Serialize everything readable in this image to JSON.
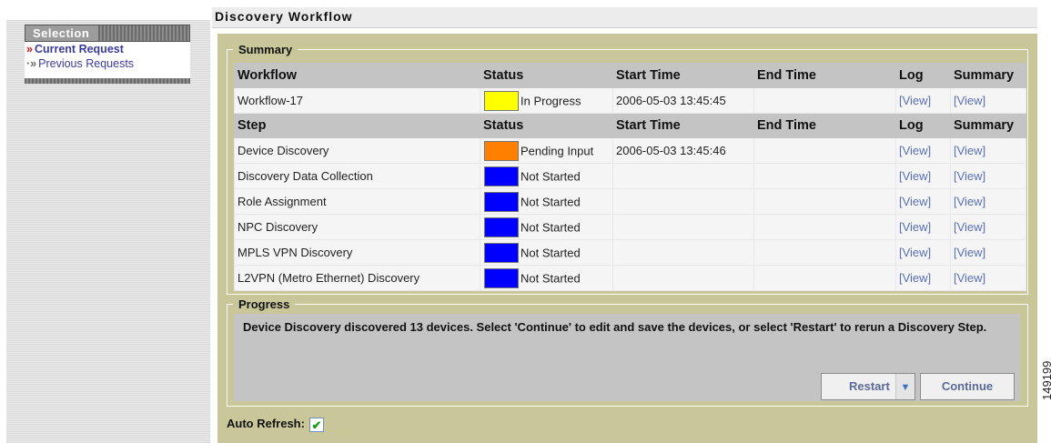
{
  "title": "Discovery Workflow",
  "sidebar": {
    "header": "Selection",
    "items": [
      {
        "label": "Current Request",
        "bullet": "»"
      },
      {
        "label": "Previous Requests",
        "bullet": "·»"
      }
    ]
  },
  "summary": {
    "legend": "Summary",
    "workflow_headers": [
      "Workflow",
      "Status",
      "Start Time",
      "End Time",
      "Log",
      "Summary"
    ],
    "workflow": {
      "name": "Workflow-17",
      "status": "In Progress",
      "status_color": "#ffff00",
      "start": "2006-05-03 13:45:45",
      "end": "",
      "log": "[View]",
      "summary": "[View]"
    },
    "step_headers": [
      "Step",
      "Status",
      "Start Time",
      "End Time",
      "Log",
      "Summary"
    ],
    "steps": [
      {
        "name": "Device Discovery",
        "status": "Pending Input",
        "status_color": "#ff7f00",
        "start": "2006-05-03 13:45:46",
        "end": "",
        "log": "[View]",
        "summary": "[View]"
      },
      {
        "name": "Discovery Data Collection",
        "status": "Not Started",
        "status_color": "#0000ff",
        "start": "",
        "end": "",
        "log": "[View]",
        "summary": "[View]"
      },
      {
        "name": "Role Assignment",
        "status": "Not Started",
        "status_color": "#0000ff",
        "start": "",
        "end": "",
        "log": "[View]",
        "summary": "[View]"
      },
      {
        "name": "NPC Discovery",
        "status": "Not Started",
        "status_color": "#0000ff",
        "start": "",
        "end": "",
        "log": "[View]",
        "summary": "[View]"
      },
      {
        "name": "MPLS VPN Discovery",
        "status": "Not Started",
        "status_color": "#0000ff",
        "start": "",
        "end": "",
        "log": "[View]",
        "summary": "[View]"
      },
      {
        "name": "L2VPN (Metro Ethernet) Discovery",
        "status": "Not Started",
        "status_color": "#0000ff",
        "start": "",
        "end": "",
        "log": "[View]",
        "summary": "[View]"
      }
    ]
  },
  "progress": {
    "legend": "Progress",
    "message": "Device Discovery discovered 13 devices. Select 'Continue' to edit and save the devices, or select 'Restart' to rerun a Discovery Step.",
    "restart_label": "Restart",
    "restart_caret_icon": "chevron-down-icon",
    "continue_label": "Continue"
  },
  "auto_refresh": {
    "label": "Auto Refresh:",
    "checked": true
  },
  "figure_id": "149199"
}
